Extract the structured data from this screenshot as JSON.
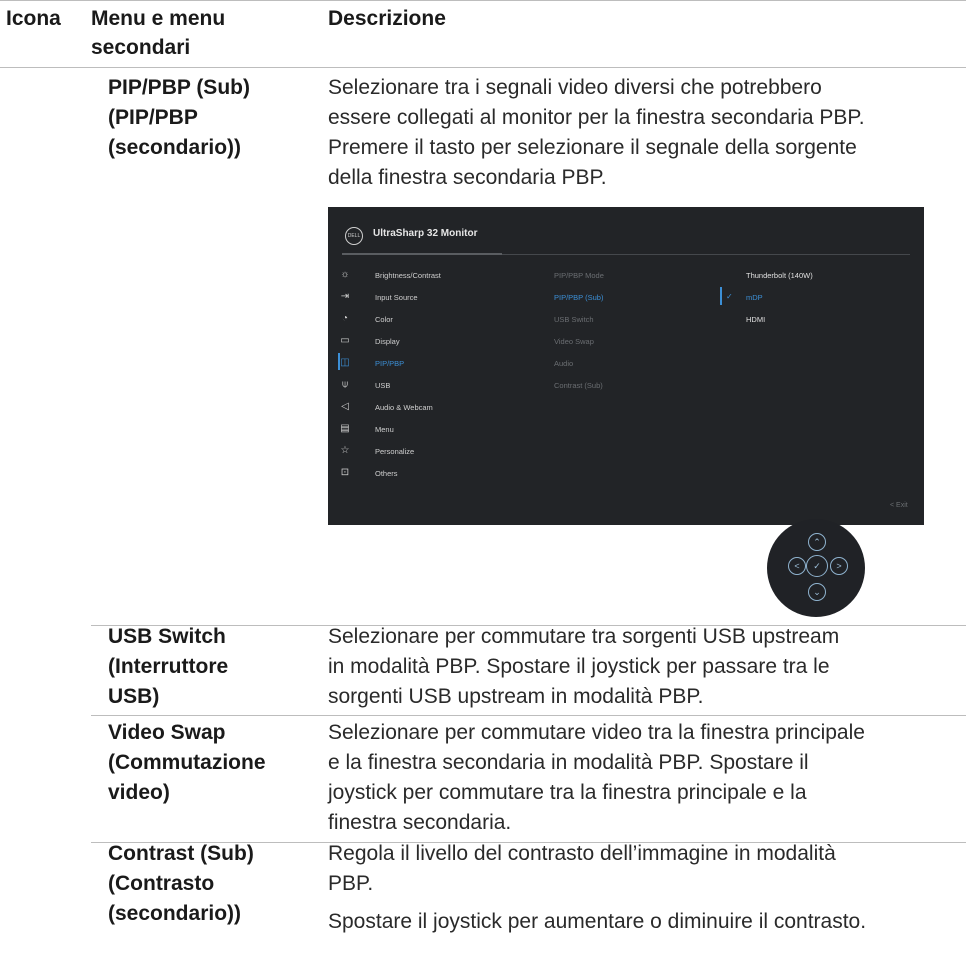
{
  "header": {
    "col_icon": "Icona",
    "col_menu_line1": "Menu e menu",
    "col_menu_line2": "secondari",
    "col_desc": "Descrizione"
  },
  "rows": {
    "pip_sub": {
      "name": [
        "PIP/PBP (Sub)",
        "(PIP/PBP",
        "(secondario))"
      ],
      "desc": [
        "Selezionare tra i segnali video diversi che potrebbero",
        "essere collegati al monitor per la finestra secondaria PBP.",
        "Premere il tasto    per selezionare il segnale della sorgente",
        "della finestra secondaria PBP."
      ]
    },
    "usb_switch": {
      "name": [
        "USB Switch",
        "(Interruttore",
        "USB)"
      ],
      "desc": [
        "Selezionare per commutare tra sorgenti USB upstream",
        "in modalità PBP. Spostare il joystick per passare tra le",
        "sorgenti USB upstream in modalità PBP."
      ]
    },
    "video_swap": {
      "name": [
        "Video Swap",
        "(Commutazione",
        "video)"
      ],
      "desc": [
        "Selezionare per commutare video tra la finestra principale",
        "e la finestra secondaria in modalità PBP. Spostare il",
        "joystick per commutare tra la finestra principale e la",
        "finestra secondaria."
      ]
    },
    "contrast_sub": {
      "name": [
        "Contrast (Sub)",
        "(Contrasto",
        "(secondario))"
      ],
      "desc": [
        "Regola il livello del contrasto dell’immagine in modalità",
        "PBP.",
        "Spostare il joystick per aumentare o diminuire il contrasto."
      ]
    }
  },
  "osd": {
    "logo": "DELL",
    "title": "UltraSharp 32 Monitor",
    "menu": [
      {
        "label": "Brightness/Contrast",
        "icon": "☼"
      },
      {
        "label": "Input Source",
        "icon": "⇥"
      },
      {
        "label": "Color",
        "icon": "◔"
      },
      {
        "label": "Display",
        "icon": "▭"
      },
      {
        "label": "PIP/PBP",
        "icon": "◫"
      },
      {
        "label": "USB",
        "icon": "⍦"
      },
      {
        "label": "Audio & Webcam",
        "icon": "◁"
      },
      {
        "label": "Menu",
        "icon": "▤"
      },
      {
        "label": "Personalize",
        "icon": "☆"
      },
      {
        "label": "Others",
        "icon": "⊡"
      }
    ],
    "submenu": [
      "PIP/PBP Mode",
      "PIP/PBP (Sub)",
      "USB Switch",
      "Video Swap",
      "Audio",
      "Contrast (Sub)"
    ],
    "options": [
      "Thunderbolt (140W)",
      "mDP",
      "HDMI"
    ],
    "check": "✓",
    "exit": "<  Exit",
    "active_color": "#3c8fd6",
    "bg_color": "#222427"
  },
  "joystick": {
    "up": "⌃",
    "down": "⌄",
    "left": "<",
    "right": ">",
    "center": "✓"
  }
}
